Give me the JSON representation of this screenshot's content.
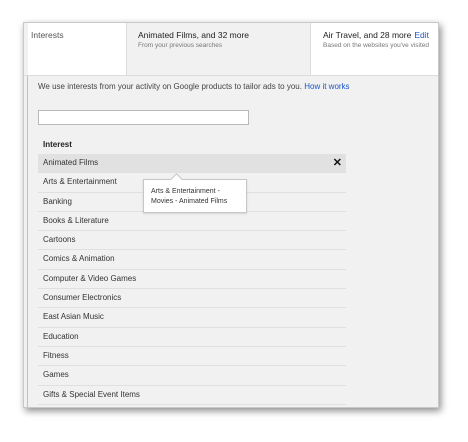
{
  "tabs": {
    "interests_label": "Interests",
    "films": {
      "title": "Animated Films, and 32 more",
      "subtitle": "From your previous searches"
    },
    "travel": {
      "title": "Air Travel, and 28 more",
      "edit_label": "Edit",
      "subtitle": "Based on the websites you've visited"
    }
  },
  "intro": {
    "text": "We use interests from your activity on Google products to tailor ads to you.",
    "link": "How it works"
  },
  "search": {
    "value": ""
  },
  "list": {
    "header": "Interest",
    "remove_symbol": "✕",
    "items": [
      "Animated Films",
      "Arts & Entertainment",
      "Banking",
      "Books & Literature",
      "Cartoons",
      "Comics & Animation",
      "Computer & Video Games",
      "Consumer Electronics",
      "East Asian Music",
      "Education",
      "Fitness",
      "Games",
      "Gifts & Special Event Items"
    ]
  },
  "tooltip": {
    "line1": "Arts & Entertainment -",
    "line2": "Movies - Animated Films"
  }
}
